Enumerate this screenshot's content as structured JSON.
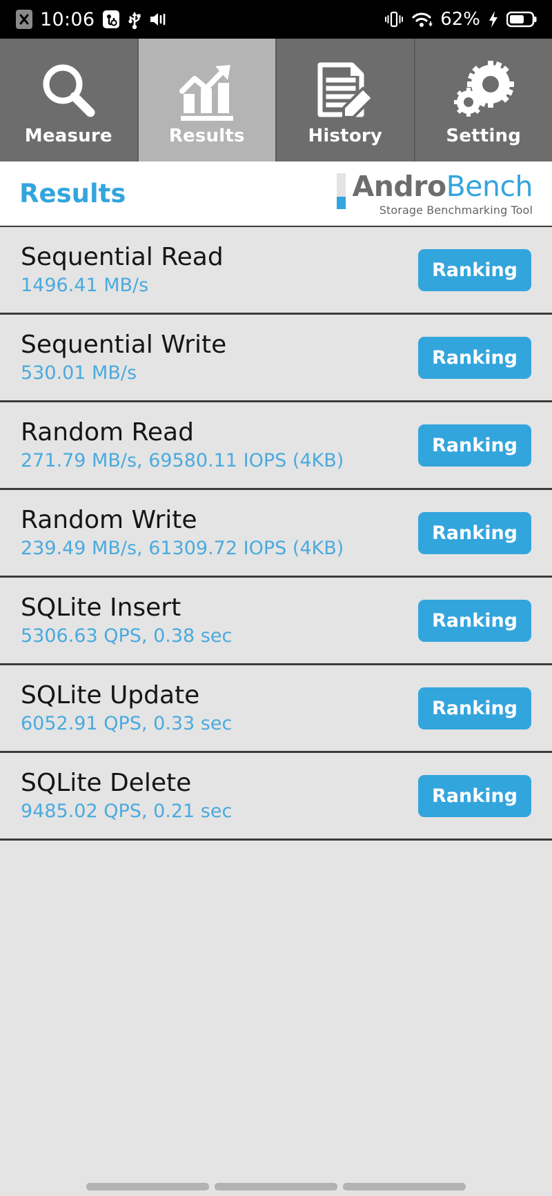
{
  "status_bar": {
    "time": "10:06",
    "battery_percent": "62%",
    "icons": [
      "x-badge-icon",
      "usb-debug-icon",
      "usb-icon",
      "volume-mute-icon",
      "vibrate-icon",
      "wifi-icon",
      "charging-bolt-icon",
      "battery-icon"
    ]
  },
  "tabs": [
    {
      "label": "Measure",
      "icon": "magnifier-icon",
      "active": false
    },
    {
      "label": "Results",
      "icon": "bar-chart-arrow-icon",
      "active": true
    },
    {
      "label": "History",
      "icon": "document-pencil-icon",
      "active": false
    },
    {
      "label": "Setting",
      "icon": "gears-icon",
      "active": false
    }
  ],
  "header": {
    "title": "Results",
    "logo_word_1": "Andro",
    "logo_word_2": "Bench",
    "logo_tagline": "Storage Benchmarking Tool"
  },
  "colors": {
    "accent_blue": "#33a5dd",
    "value_blue": "#4aaade",
    "logo_gray": "#6d6d6d",
    "tab_inactive": "#6d6d6d",
    "tab_active": "#b4b4b4",
    "row_bg": "#e4e4e4",
    "row_divider": "#3b3b3b"
  },
  "results": [
    {
      "title": "Sequential Read",
      "value": "1496.41 MB/s",
      "button": "Ranking"
    },
    {
      "title": "Sequential Write",
      "value": "530.01 MB/s",
      "button": "Ranking"
    },
    {
      "title": "Random Read",
      "value": "271.79 MB/s, 69580.11 IOPS (4KB)",
      "button": "Ranking"
    },
    {
      "title": "Random Write",
      "value": "239.49 MB/s, 61309.72 IOPS (4KB)",
      "button": "Ranking"
    },
    {
      "title": "SQLite Insert",
      "value": "5306.63 QPS, 0.38 sec",
      "button": "Ranking"
    },
    {
      "title": "SQLite Update",
      "value": "6052.91 QPS, 0.33 sec",
      "button": "Ranking"
    },
    {
      "title": "SQLite Delete",
      "value": "9485.02 QPS, 0.21 sec",
      "button": "Ranking"
    }
  ],
  "nav_bar": {
    "pills": 3
  }
}
